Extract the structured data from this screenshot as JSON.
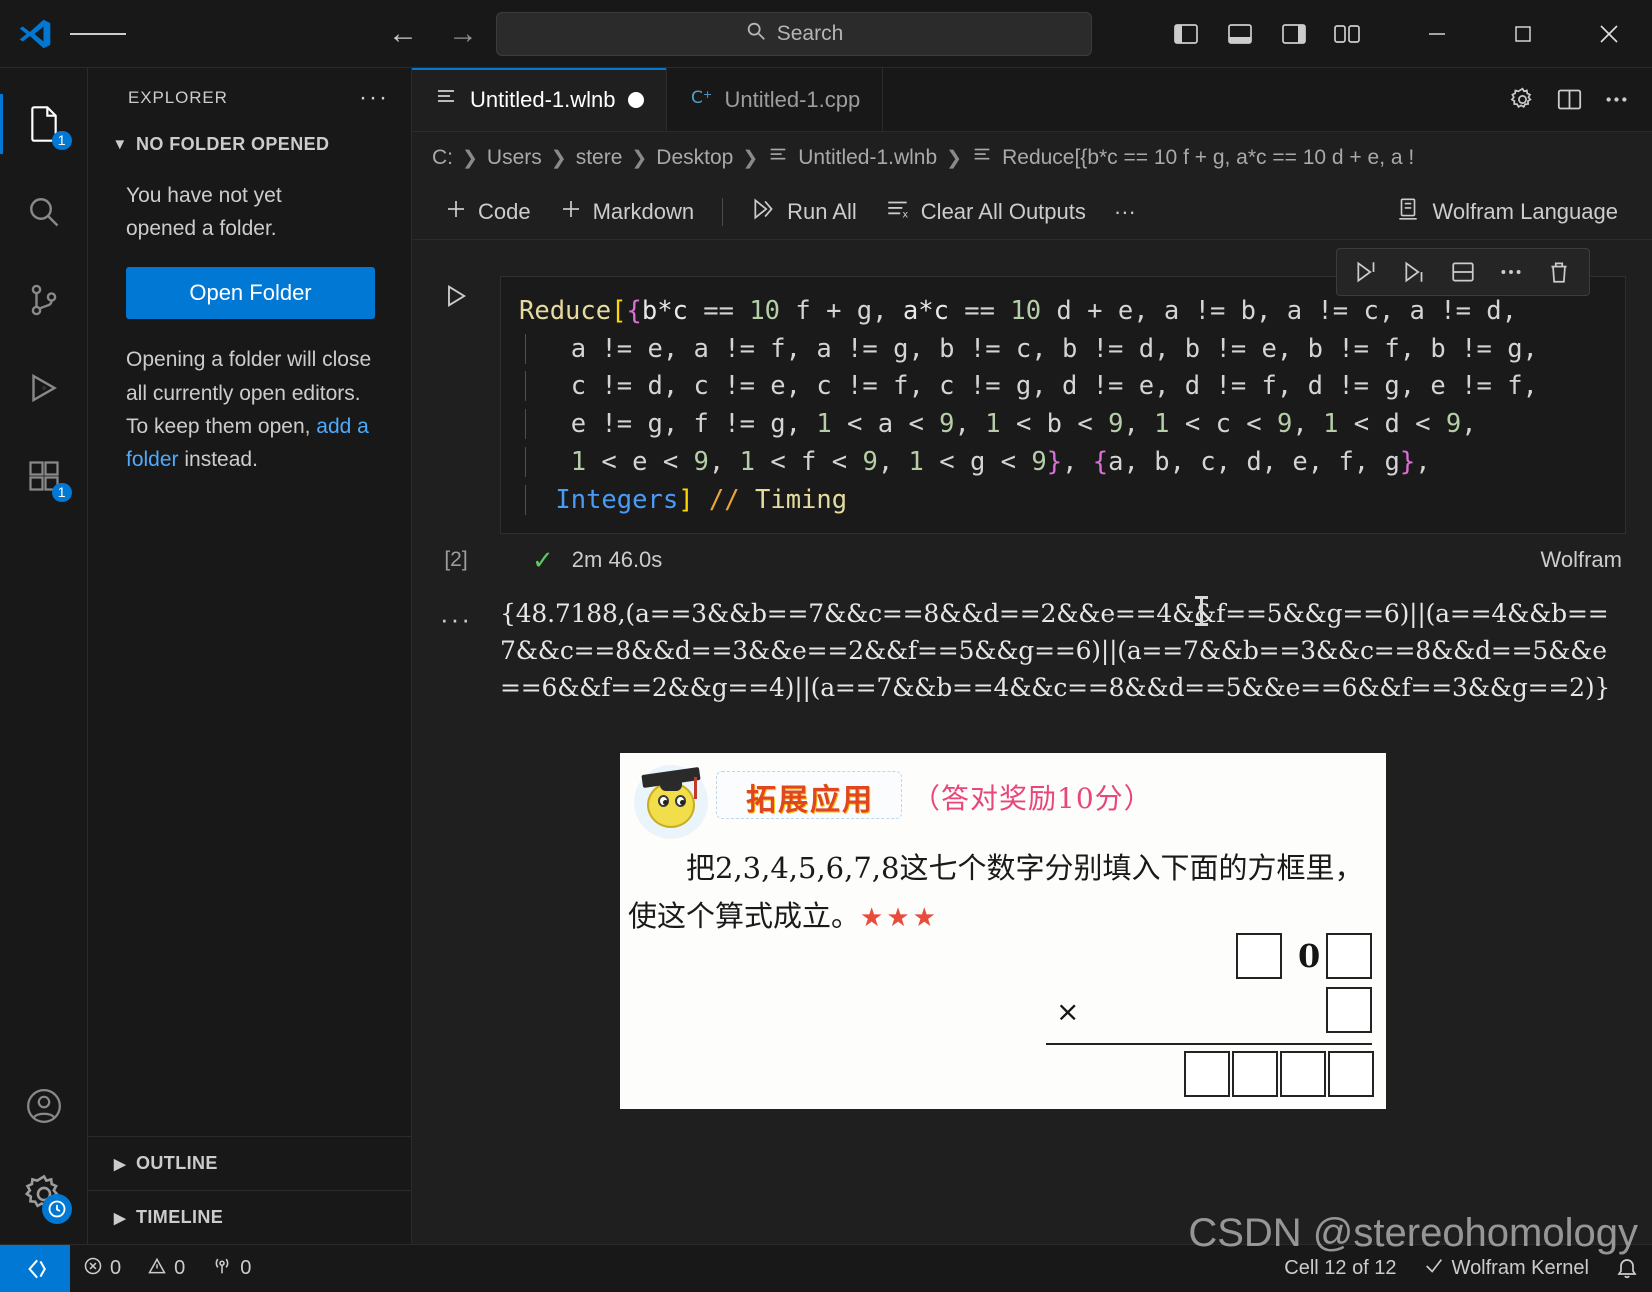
{
  "titlebar": {
    "search_placeholder": "Search",
    "icons": [
      "menu-icon",
      "back-arrow-icon",
      "forward-arrow-icon",
      "search-icon",
      "toggle-primary-sidebar-icon",
      "toggle-panel-icon",
      "toggle-secondary-sidebar-icon",
      "customize-layout-icon"
    ],
    "minimize": "─",
    "maximize": "☐",
    "close": "✕"
  },
  "activitybar": {
    "items": [
      {
        "name": "explorer",
        "badge": "1",
        "active": true
      },
      {
        "name": "search",
        "badge": "",
        "active": false
      },
      {
        "name": "source-control",
        "badge": "",
        "active": false
      },
      {
        "name": "run-and-debug",
        "badge": "",
        "active": false
      },
      {
        "name": "extensions",
        "badge": "1",
        "active": false
      }
    ],
    "bottom": [
      {
        "name": "accounts",
        "badge": ""
      },
      {
        "name": "settings",
        "badge": "clock"
      }
    ]
  },
  "sidebar": {
    "title": "EXPLORER",
    "more_actions": "···",
    "section_title": "NO FOLDER OPENED",
    "message_line1": "You have not yet",
    "message_line2": "opened a folder.",
    "open_folder_button": "Open Folder",
    "hint_before_link": "Opening a folder will close all currently open editors. To keep them open, ",
    "hint_link": "add a folder",
    "hint_after_link": " instead.",
    "outline": "OUTLINE",
    "timeline": "TIMELINE"
  },
  "editor": {
    "tabs": [
      {
        "label": "Untitled-1.wlnb",
        "icon": "notebook-icon",
        "active": true,
        "dirty": true
      },
      {
        "label": "Untitled-1.cpp",
        "icon": "cpp-icon",
        "active": false,
        "dirty": false
      }
    ],
    "tab_actions": [
      "gear-icon",
      "split-editor-icon",
      "more-actions-icon"
    ],
    "breadcrumb": [
      "C:",
      "Users",
      "stere",
      "Desktop",
      "Untitled-1.wlnb",
      "Reduce[{b*c == 10 f + g, a*c == 10 d + e, a !"
    ],
    "toolbar": {
      "add_code": "Code",
      "add_markdown": "Markdown",
      "run_all": "Run All",
      "clear_all_outputs": "Clear All Outputs",
      "more": "···",
      "kernel": "Wolfram Language"
    },
    "cell_toolbar": [
      "run-by-line-icon",
      "execute-below-icon",
      "split-cell-icon",
      "more-icon",
      "delete-cell-icon"
    ]
  },
  "cell": {
    "execution_count": "[2]",
    "status_icon": "check-icon",
    "elapsed": "2m 46.0s",
    "kernel_label": "Wolfram",
    "code_lines": [
      "Reduce[{b*c == 10 f + g, a*c == 10 d + e, a != b, a != c, a != d,",
      "   a != e, a != f, a != g, b != c, b != d, b != e, b != f, b != g,",
      "   c != d, c != e, c != f, c != g, d != e, d != f, d != g, e != f,",
      "   e != g, f != g, 1 < a < 9, 1 < b < 9, 1 < c < 9, 1 < d < 9,",
      "   1 < e < 9, 1 < f < 9, 1 < g < 9}, {a, b, c, d, e, f, g},",
      "  Integers] // Timing"
    ],
    "output_prefix": "···",
    "output_text": "{48.7188,(a==3&&b==7&&c==8&&d==2&&e==4&&f==5&&g==6)||(a==4&&b==7&&c==8&&d==3&&e==2&&f==5&&g==6)||(a==7&&b==3&&c==8&&d==5&&e==6&&f==2&&g==4)||(a==7&&b==4&&c==8&&d==5&&e==6&&f==3&&g==2)}"
  },
  "output_image": {
    "badge_title": "拓展应用",
    "badge_note": "（答对奖励10分）",
    "question_line1": "把2,3,4,5,6,7,8这七个数字分别填入下面的方框里，",
    "question_line2": "使这个算式成立。",
    "stars": "★★★",
    "digit_zero": "0",
    "multiply_sign": "×"
  },
  "statusbar": {
    "remote_icon": "remote-window-icon",
    "errors": "0",
    "warnings": "0",
    "ports": "0",
    "cell_position": "Cell 12 of 12",
    "kernel": "Wolfram Kernel",
    "bell_icon": "notifications-icon"
  },
  "watermark": "CSDN @stereohomology",
  "colors": {
    "accent": "#0078d4",
    "editor_bg": "#1f1f1f",
    "panel_bg": "#181818",
    "code_bg": "#1a1a1a",
    "success": "#5ec75e"
  }
}
